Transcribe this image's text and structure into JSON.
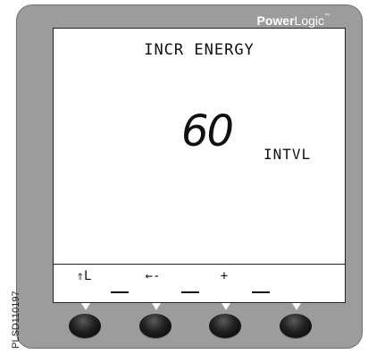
{
  "brand": {
    "bold": "Power",
    "light": "Logic",
    "mark": "™"
  },
  "display": {
    "title": "INCR ENERGY",
    "value": "60",
    "unit": "INTVL"
  },
  "softkeys": [
    {
      "label": "⇑L",
      "icon": "up-level-icon"
    },
    {
      "label": "←-",
      "icon": "back-arrow-icon"
    },
    {
      "label": "+",
      "icon": "plus-icon"
    },
    {
      "label": "",
      "icon": "blank"
    }
  ],
  "side_code": "PLSD110197"
}
